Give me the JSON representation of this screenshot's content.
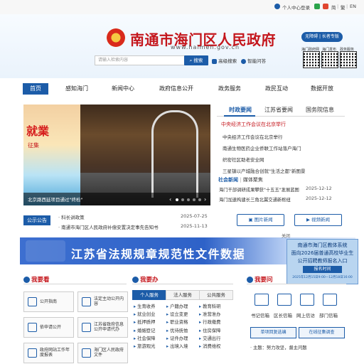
{
  "topbar": {
    "user_center": "个人中心",
    "login": "登录",
    "lang_cn": "简",
    "lang_tw": "繁",
    "lang_en": "EN",
    "sep": "|"
  },
  "header": {
    "title": "南通市海门区人民政府",
    "domain": "www.haimen.gov.cn",
    "search_placeholder": "请输入检索内容",
    "search_button": "搜索",
    "advanced_search": "高级搜索",
    "smart_qa": "智能问答",
    "accessible": "无障碍 | 长者专版",
    "qr_captions": [
      "海门政府网",
      "海门发布",
      "政务服务"
    ]
  },
  "nav": [
    "首页",
    "感知海门",
    "新闻中心",
    "政府信息公开",
    "政务服务",
    "政民互动",
    "数据开放"
  ],
  "carousel": {
    "caption": "北京路西延项目通过\"终检\"",
    "left_big": "就業",
    "left_small": "征集"
  },
  "notice": {
    "tag": "公示公告",
    "items": [
      {
        "text": "· 科长讲政策",
        "date": "2025-07-25"
      },
      {
        "text": "· 南通市海门区人民政府补偿安置决定事先告知书",
        "date": "2025-11-13"
      }
    ]
  },
  "news": {
    "tabs": [
      "时政要闻",
      "江苏省要闻",
      "国务院信息"
    ],
    "headline": "中央经济工作会议在北京举行",
    "items": [
      "中央经济工作会议在北京举行",
      "南通生物医药企业侨联工作站落户海门",
      "织密社区助老安全网",
      "三星镇以产城融合创就\"生活之都\"新图景"
    ],
    "sub_tabs": [
      "社会新闻",
      "媒体聚焦"
    ],
    "sub_sep": "|",
    "sub_items": [
      {
        "text": "海门干部调研成果攀获\"十五五\"发展蓝图",
        "date": "2025-12-12"
      },
      {
        "text": "海门加速构建长三角北翼交通新枢纽",
        "date": "2025-12-12"
      }
    ],
    "photo_news": "图片新闻",
    "video_news": "视频新闻"
  },
  "banner": {
    "text": "江苏省法规规章规范性文件数据"
  },
  "float": {
    "close": "关闭",
    "lines": [
      "南通市海门区教体系统",
      "面向2026届普通高校毕业生",
      "公开招聘教师报名入口"
    ],
    "button": "报名时间",
    "date": "2025年12月15日9:00—12月18日16:00"
  },
  "section_see": {
    "title": "我要看",
    "tiles": [
      "公开指南",
      "法定主动公开内容",
      "依申请公开",
      "江苏省政府信息公开申请代办",
      "政府网站工作年度报表",
      "海门区人民政府文件"
    ]
  },
  "section_do": {
    "title": "我要办",
    "tabs": [
      "个人服务",
      "法人服务",
      "公共服务"
    ],
    "items": [
      "生育收养",
      "户籍办理",
      "教育科研",
      "就业创业",
      "设立变更",
      "准营准办",
      "抵押质押",
      "职业资格",
      "行政缴费",
      "婚姻登记",
      "优待抚恤",
      "住房保障",
      "社会保障",
      "证件办理",
      "交通出行",
      "旅游观光",
      "出境入境",
      "消费维权"
    ]
  },
  "section_ask": {
    "title": "我要问",
    "icons": [
      "书记信箱",
      "区长信箱",
      "网上信访",
      "部门信箱"
    ],
    "buttons": [
      "单项回复选编",
      "在线征集调查"
    ],
    "row": "· 主题：努力攻坚，督主问题"
  },
  "colors": {
    "brand_blue": "#1c5ca8",
    "brand_red": "#c4161c"
  }
}
